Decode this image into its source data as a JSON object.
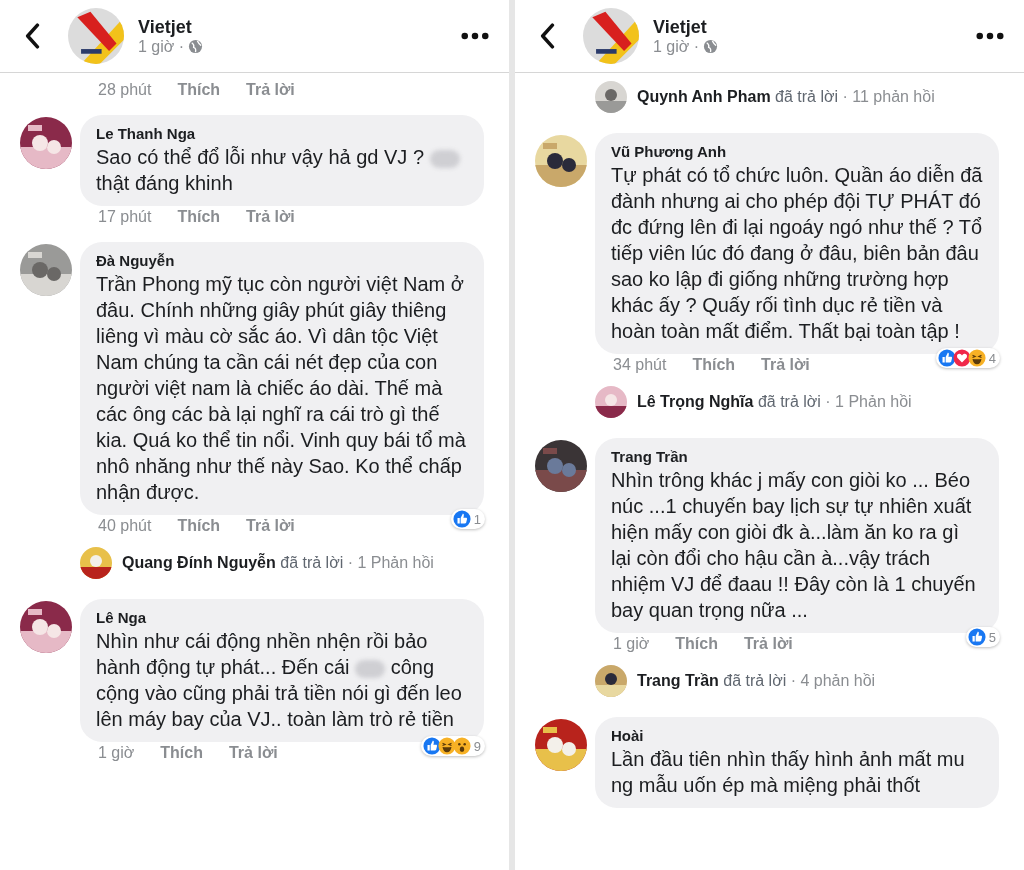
{
  "panels": [
    {
      "page_title": "Vietjet",
      "post_time": "1 giờ ·",
      "feed": [
        {
          "kind": "actions",
          "time": "28 phút",
          "like": "Thích",
          "reply": "Trả lời"
        },
        {
          "kind": "comment",
          "name": "Le Thanh Nga",
          "body": [
            {
              "kind": "text",
              "text": "Sao có thể đổ lỗi như vậy hả gd VJ ? "
            },
            {
              "kind": "blur"
            },
            {
              "kind": "text",
              "text": " thật đáng khinh"
            }
          ]
        },
        {
          "kind": "actions",
          "time": "17 phút",
          "like": "Thích",
          "reply": "Trả lời"
        },
        {
          "kind": "comment",
          "name": "Đà Nguyễn",
          "body": [
            {
              "kind": "text",
              "text": "Trần  Phong mỹ  tục còn  người  việt Nam ở  đâu.  Chính  những  giây  phút giây thiêng liêng vì  màu  cờ  sắc  áo. Vì  dân tộc Việt Nam chúng  ta cần  cái nét  đẹp của  con người  việt nam  là chiếc  áo  dài.  Thế  mà  các  ông các bà  lại nghĩ  ra cái  trò  gì  thế  kia.  Quá ko thể  tin nổi.  Vinh quy bái  tổ mà nhô nhăng như  thế  này  Sao.  Ko thể chấp  nhận được."
            }
          ]
        },
        {
          "kind": "actions",
          "time": "40 phút",
          "like": "Thích",
          "reply": "Trả lời",
          "reactions": [
            {
              "kind": "like"
            }
          ],
          "count": "1"
        },
        {
          "kind": "replies",
          "name": "Quang Đính Nguyễn",
          "verb": "đã trả lời",
          "count": "· 1 Phản hồi"
        },
        {
          "kind": "comment",
          "name": "Lê Nga",
          "body": [
            {
              "kind": "text",
              "text": "Nhìn như cái động nhền nhện rồi bảo hành động tự phát... Đến cái "
            },
            {
              "kind": "blur"
            },
            {
              "kind": "text",
              "text": " công cộng vào cũng phải trả tiền nói gì đến leo lên máy bay của VJ.. toàn làm trò rẻ tiền"
            }
          ]
        },
        {
          "kind": "actions",
          "time": "1 giờ",
          "like": "Thích",
          "reply": "Trả lời",
          "reactions": [
            {
              "kind": "like"
            },
            {
              "kind": "haha"
            },
            {
              "kind": "wow"
            }
          ],
          "count": "9"
        }
      ]
    },
    {
      "page_title": "Vietjet",
      "post_time": "1 giờ ·",
      "feed": [
        {
          "kind": "replies",
          "name": "Quynh Anh Pham",
          "verb": "đã trả lời",
          "count": "· 11 phản hồi"
        },
        {
          "kind": "comment",
          "name": "Vũ Phương Anh",
          "body": [
            {
              "kind": "text",
              "text": "Tự phát có tổ chức luôn. Quần áo diễn đã đành nhưng ai cho phép đội TỰ PHÁT đó đc đứng lên đi lại ngoáy ngó như thế ? Tổ tiếp viên lúc đó đang ở đâu, biên bản đâu sao ko lập đi giống những trường hợp khác ấy ? Quấy rối tình dục rẻ tiền và hoàn toàn mất điểm. Thất bại toàn tập !"
            }
          ]
        },
        {
          "kind": "actions",
          "time": "34 phút",
          "like": "Thích",
          "reply": "Trả lời",
          "reactions": [
            {
              "kind": "like"
            },
            {
              "kind": "love"
            },
            {
              "kind": "haha"
            }
          ],
          "count": "4"
        },
        {
          "kind": "replies",
          "name": "Lê Trọng Nghĩa",
          "verb": "đã trả lời",
          "count": "· 1 Phản hồi"
        },
        {
          "kind": "comment",
          "name": "Trang Trần",
          "body": [
            {
              "kind": "text",
              "text": "Nhìn trông khác j mấy con giòi ko ... Béo núc ...1 chuyến bay lịch sự tự nhiên xuất hiện mấy con giòi đk à...làm ăn ko ra gì lại còn đổi cho hậu cần à...vậy trách nhiệm VJ để đaau !! Đây còn là 1 chuyến bay quan trọng nữa ..."
            }
          ]
        },
        {
          "kind": "actions",
          "time": "1 giờ",
          "like": "Thích",
          "reply": "Trả lời",
          "reactions": [
            {
              "kind": "like"
            }
          ],
          "count": "5"
        },
        {
          "kind": "replies",
          "name": "Trang Trần",
          "verb": "đã trả lời",
          "count": "· 4 phản hồi"
        },
        {
          "kind": "comment",
          "name": "Hoài",
          "body": [
            {
              "kind": "text",
              "text": "Lần đầu tiên nhìn thấy hình ảnh mất mu ng mẫu uốn ép mà miệng phải thốt"
            }
          ]
        }
      ]
    }
  ]
}
